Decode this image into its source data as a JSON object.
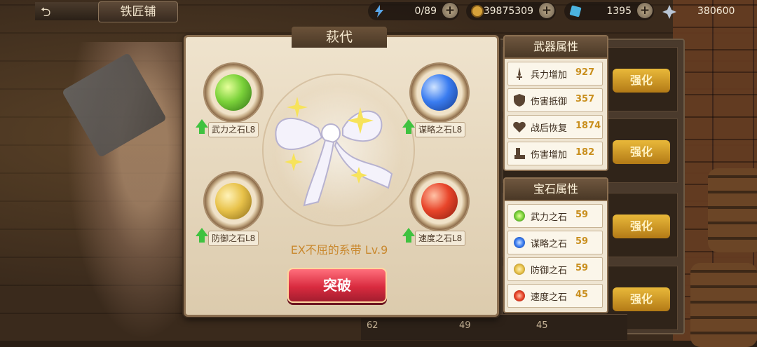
{
  "topbar": {
    "title": "铁匠铺",
    "stamina": "0/89",
    "gold": "39875309",
    "scrolls": "1395",
    "crystals": "380600"
  },
  "panel": {
    "title": "萩代",
    "item_name": "EX不屈的系带 Lv.9",
    "break_label": "突破",
    "gems": [
      {
        "label": "武力之石L8",
        "color": "#7bd23a"
      },
      {
        "label": "谋略之石L8",
        "color": "#3a7cf0"
      },
      {
        "label": "防御之石L8",
        "color": "#e8c24a"
      },
      {
        "label": "速度之石L8",
        "color": "#e8452a"
      }
    ]
  },
  "weapon_attrs": {
    "title": "武器属性",
    "rows": [
      {
        "label": "兵力增加",
        "value": "927",
        "icon": "sword-icon"
      },
      {
        "label": "伤害抵御",
        "value": "357",
        "icon": "shield-icon"
      },
      {
        "label": "战后恢复",
        "value": "1874",
        "icon": "heal-icon"
      },
      {
        "label": "伤害增加",
        "value": "182",
        "icon": "boot-icon"
      }
    ]
  },
  "gem_attrs": {
    "title": "宝石属性",
    "rows": [
      {
        "label": "武力之石",
        "value": "59",
        "color": "#7bd23a"
      },
      {
        "label": "谋略之石",
        "value": "59",
        "color": "#3a7cf0"
      },
      {
        "label": "防御之石",
        "value": "59",
        "color": "#e8c24a"
      },
      {
        "label": "速度之石",
        "value": "45",
        "color": "#e8452a"
      }
    ]
  },
  "background": {
    "upgrade_label": "强化",
    "bottom_values": [
      "62",
      "49",
      "45"
    ]
  }
}
